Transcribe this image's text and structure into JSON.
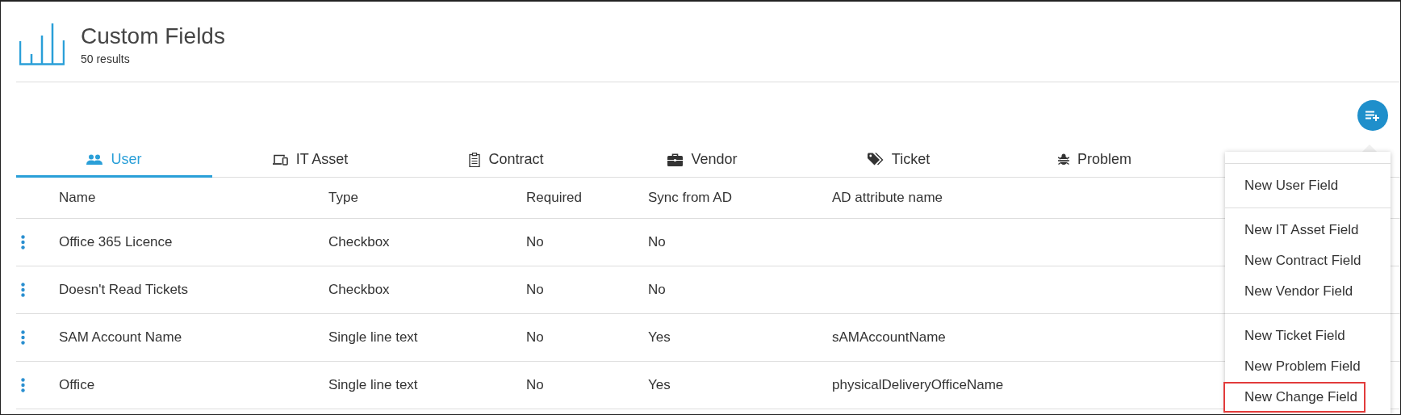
{
  "header": {
    "title": "Custom Fields",
    "subtitle": "50 results"
  },
  "tabs": [
    {
      "label": "User",
      "selected": true
    },
    {
      "label": "IT Asset",
      "selected": false
    },
    {
      "label": "Contract",
      "selected": false
    },
    {
      "label": "Vendor",
      "selected": false
    },
    {
      "label": "Ticket",
      "selected": false
    },
    {
      "label": "Problem",
      "selected": false
    }
  ],
  "table": {
    "columns": [
      "Name",
      "Type",
      "Required",
      "Sync from AD",
      "AD attribute name"
    ],
    "rows": [
      [
        "Office 365 Licence",
        "Checkbox",
        "No",
        "No",
        ""
      ],
      [
        "Doesn't Read Tickets",
        "Checkbox",
        "No",
        "No",
        ""
      ],
      [
        "SAM Account Name",
        "Single line text",
        "No",
        "Yes",
        "sAMAccountName"
      ],
      [
        "Office",
        "Single line text",
        "No",
        "Yes",
        "physicalDeliveryOfficeName"
      ]
    ]
  },
  "new_menu": {
    "sections": [
      [
        {
          "label": "New User Field",
          "highlighted": false
        }
      ],
      [
        {
          "label": "New IT Asset Field",
          "highlighted": false
        },
        {
          "label": "New Contract Field",
          "highlighted": false
        },
        {
          "label": "New Vendor Field",
          "highlighted": false
        }
      ],
      [
        {
          "label": "New Ticket Field",
          "highlighted": false
        },
        {
          "label": "New Problem Field",
          "highlighted": false
        },
        {
          "label": "New Change Field",
          "highlighted": true
        }
      ]
    ]
  }
}
